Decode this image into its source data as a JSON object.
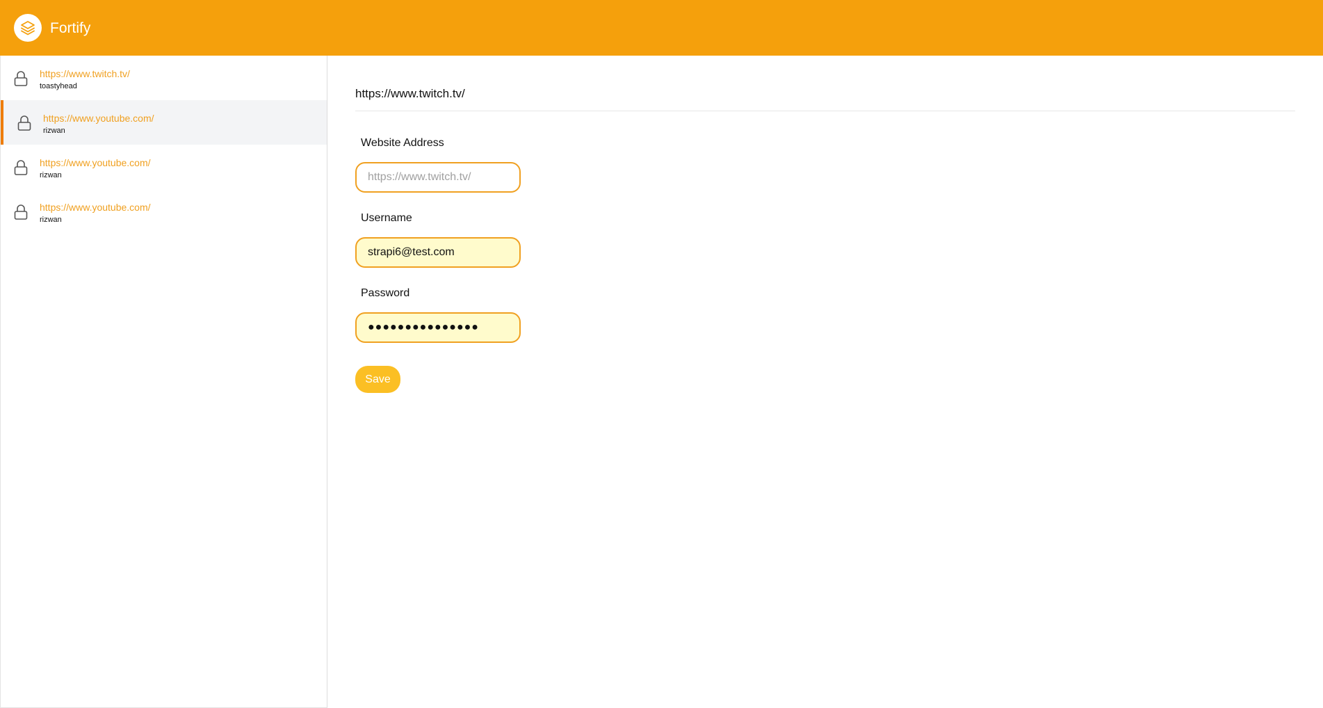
{
  "app": {
    "title": "Fortify",
    "logo_icon": "layers-icon",
    "accent_color": "#f5a00c"
  },
  "sidebar": {
    "items": [
      {
        "url": "https://www.twitch.tv/",
        "username": "toastyhead",
        "icon": "lock-icon",
        "active": false
      },
      {
        "url": "https://www.youtube.com/",
        "username": "rizwan",
        "icon": "lock-icon",
        "active": true
      },
      {
        "url": "https://www.youtube.com/",
        "username": "rizwan",
        "icon": "lock-icon",
        "active": false
      },
      {
        "url": "https://www.youtube.com/",
        "username": "rizwan",
        "icon": "lock-icon",
        "active": false
      }
    ]
  },
  "detail": {
    "title": "https://www.twitch.tv/",
    "website": {
      "label": "Website Address",
      "value": "",
      "placeholder": "https://www.twitch.tv/"
    },
    "username": {
      "label": "Username",
      "value": "strapi6@test.com"
    },
    "password": {
      "label": "Password",
      "value": "●●●●●●●●●●●●●●●"
    },
    "save_label": "Save"
  }
}
